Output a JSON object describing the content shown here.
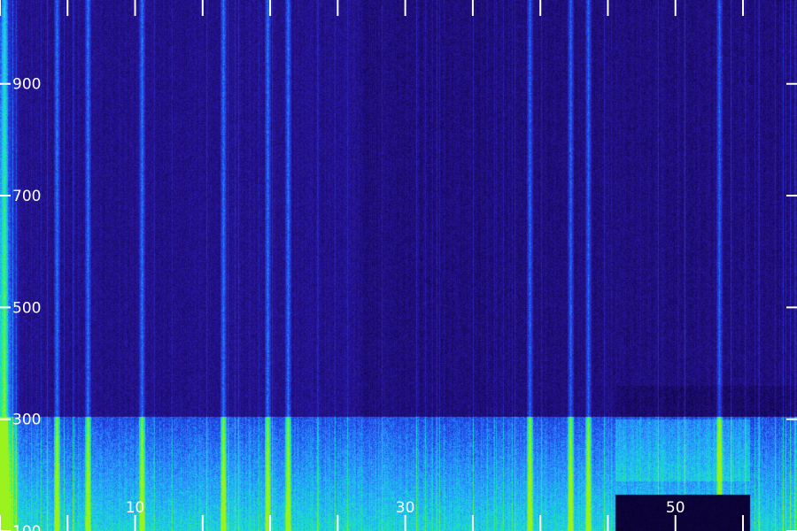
{
  "chart_data": {
    "type": "heatmap",
    "title": "",
    "xlabel": "",
    "ylabel": "",
    "xlim": [
      0,
      59
    ],
    "ylim": [
      100,
      1050
    ],
    "x_tick_step": 5,
    "x_tick_labels": [
      {
        "value": 10,
        "text": "10"
      },
      {
        "value": 30,
        "text": "30"
      },
      {
        "value": 50,
        "text": "50"
      }
    ],
    "y_tick_labels": [
      {
        "value": 100,
        "text": "100"
      },
      {
        "value": 300,
        "text": "300"
      },
      {
        "value": 500,
        "text": "500"
      },
      {
        "value": 700,
        "text": "700"
      },
      {
        "value": 900,
        "text": "900"
      }
    ],
    "grid": false,
    "colormap": [
      "#05001e",
      "#1a0a6b",
      "#2a1aa8",
      "#1e40e0",
      "#2a8cff",
      "#19d2e6",
      "#2cf07a",
      "#9af21e"
    ],
    "tick_color": "#ffffff",
    "features": {
      "low_band_top": 305,
      "left_edge_strong_until": 1,
      "right_black_region": {
        "x": [
          45.5,
          55.5
        ],
        "y": [
          100,
          165
        ]
      },
      "right_band_region": {
        "x": [
          45.5,
          55.5
        ],
        "y": [
          190,
          300
        ]
      },
      "bright_columns": [
        0.3,
        4.2,
        6.5,
        10.5,
        16.5,
        19.8,
        21.3,
        39.2,
        42.2,
        43.5,
        53.2
      ]
    }
  }
}
